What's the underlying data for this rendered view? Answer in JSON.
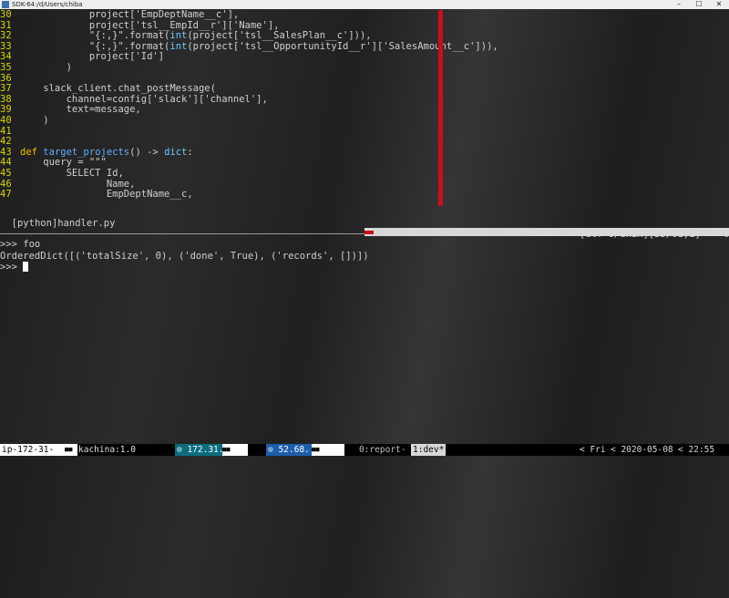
{
  "window": {
    "title": "SDK-64:/d/Users/chiba",
    "min": "–",
    "max": "☐",
    "close": "✕"
  },
  "editor": {
    "lines": [
      {
        "n": "30",
        "segs": [
          {
            "t": "            project['EmpDeptName__c'],",
            "c": "str"
          }
        ]
      },
      {
        "n": "31",
        "segs": [
          {
            "t": "            project['tsl__EmpId__r']['Name'],",
            "c": "str"
          }
        ]
      },
      {
        "n": "32",
        "segs": [
          {
            "t": "            \"{:,}\".format(",
            "c": "str"
          },
          {
            "t": "int",
            "c": "builtin"
          },
          {
            "t": "(project['tsl__SalesPlan__c'])),",
            "c": "str"
          }
        ]
      },
      {
        "n": "33",
        "segs": [
          {
            "t": "            \"{:,}\".format(",
            "c": "str"
          },
          {
            "t": "int",
            "c": "builtin"
          },
          {
            "t": "(project['tsl__OpportunityId__r']['SalesAmount__c'])),",
            "c": "str"
          }
        ]
      },
      {
        "n": "34",
        "segs": [
          {
            "t": "            project['Id']",
            "c": "str"
          }
        ]
      },
      {
        "n": "35",
        "segs": [
          {
            "t": "        )",
            "c": "str"
          }
        ]
      },
      {
        "n": "36",
        "segs": [
          {
            "t": "",
            "c": "str"
          }
        ]
      },
      {
        "n": "37",
        "segs": [
          {
            "t": "    slack_client.chat_postMessage(",
            "c": "str"
          }
        ]
      },
      {
        "n": "38",
        "segs": [
          {
            "t": "        channel=config['slack']['channel'],",
            "c": "str"
          }
        ]
      },
      {
        "n": "39",
        "segs": [
          {
            "t": "        text=message,",
            "c": "str"
          }
        ]
      },
      {
        "n": "40",
        "segs": [
          {
            "t": "    )",
            "c": "str"
          }
        ]
      },
      {
        "n": "41",
        "segs": [
          {
            "t": "",
            "c": "str"
          }
        ]
      },
      {
        "n": "42",
        "segs": [
          {
            "t": "",
            "c": "str"
          }
        ]
      },
      {
        "n": "43",
        "segs": [
          {
            "t": "def ",
            "c": "kw"
          },
          {
            "t": "target_projects",
            "c": "fn"
          },
          {
            "t": "() -> ",
            "c": "str"
          },
          {
            "t": "dict",
            "c": "builtin"
          },
          {
            "t": ":",
            "c": "str"
          }
        ]
      },
      {
        "n": "44",
        "segs": [
          {
            "t": "    query = \"\"\"",
            "c": "str"
          }
        ]
      },
      {
        "n": "45",
        "segs": [
          {
            "t": "        SELECT Id,",
            "c": "str"
          }
        ]
      },
      {
        "n": "46",
        "segs": [
          {
            "t": "               Name,",
            "c": "str"
          }
        ]
      },
      {
        "n": "47",
        "segs": [
          {
            "t": "               EmpDeptName__c,",
            "c": "str"
          }
        ]
      }
    ]
  },
  "statusline": {
    "filename": "[python]handler.py",
    "info": "[utf-8/unix][35/61,1]    67%"
  },
  "repl": {
    "lines": [
      ">>> foo",
      "OrderedDict([('totalSize', 0), ('done', True), ('records', [])])",
      ">>> "
    ]
  },
  "tmux": {
    "host": "ip-172-31-",
    "session": "kachina:1.0",
    "ip1": "⊙ 172.31.",
    "ip2": "⊙ 52.68.",
    "win_report": "0:report-",
    "win_dev": "1:dev*",
    "day": "< Fri",
    "date": "< 2020-05-08",
    "time": "< 22:55",
    "mini_mark": "■■"
  },
  "colors": {
    "colorcolumn": "#c8101a",
    "line_number": "#d7d700",
    "keyword": "#e8c400",
    "function": "#5fb0ff"
  }
}
